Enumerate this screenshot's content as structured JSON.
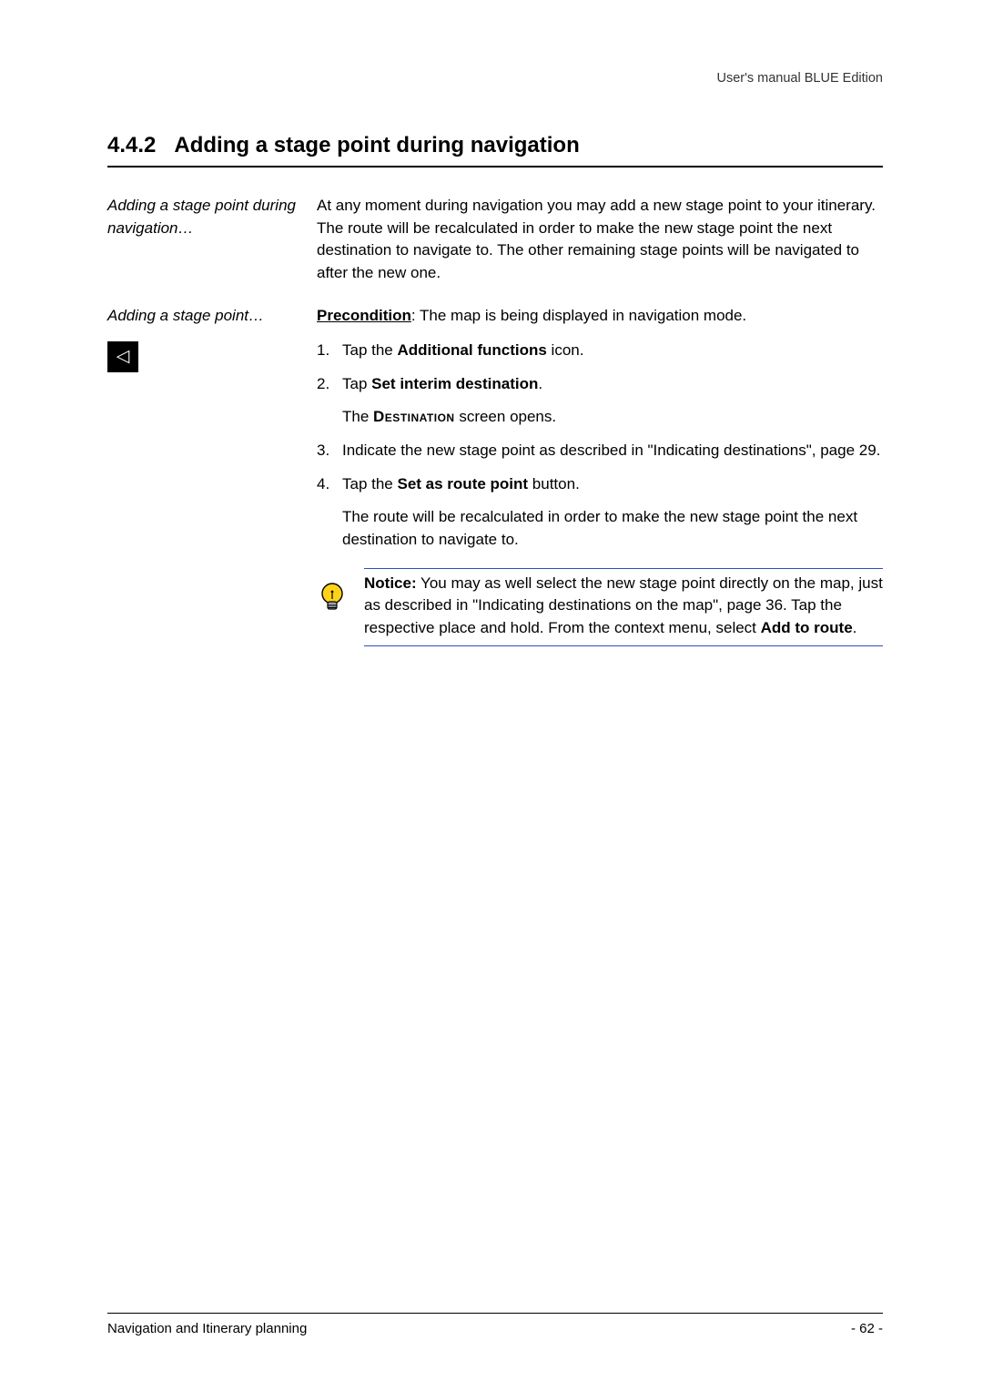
{
  "header": {
    "right_text": "User's manual BLUE Edition"
  },
  "section": {
    "number": "4.4.2",
    "title": "Adding a stage point during navigation"
  },
  "block1": {
    "side_label": "Adding a stage point during navigation…",
    "body": "At any moment during navigation you may add a new stage point to your itinerary. The route will be recalculated in order to make the new stage point the next destination to navigate to. The other remaining stage points will be navigated to after the new one."
  },
  "block2": {
    "side_label": "Adding a stage point…",
    "precondition_label": "Precondition",
    "precondition_text": ": The map is being displayed in navigation mode."
  },
  "icon_glyph": "◁",
  "steps": {
    "s1_num": "1.",
    "s1_a": "Tap the ",
    "s1_b": "Additional functions",
    "s1_c": " icon.",
    "s2_num": "2.",
    "s2_a": "Tap ",
    "s2_b": "Set interim destination",
    "s2_c": ".",
    "s2_sub_a": "The ",
    "s2_sub_b": "Destination",
    "s2_sub_c": " screen opens.",
    "s3_num": "3.",
    "s3_text": "Indicate the new stage point as described in \"Indicating destinations\", page 29.",
    "s4_num": "4.",
    "s4_a": "Tap the ",
    "s4_b": "Set as route point",
    "s4_c": " button.",
    "s4_sub": "The route will be recalculated in order to make the new stage point the next destination to navigate to."
  },
  "notice": {
    "label": "Notice:",
    "body_a": " You may as well select the new stage point directly on the map, just as described in \"Indicating destinations on the map\", page 36. Tap the respective place and hold. From the context menu, select ",
    "body_b": "Add to route",
    "body_c": "."
  },
  "footer": {
    "left": "Navigation and Itinerary planning",
    "right": "- 62 -"
  }
}
